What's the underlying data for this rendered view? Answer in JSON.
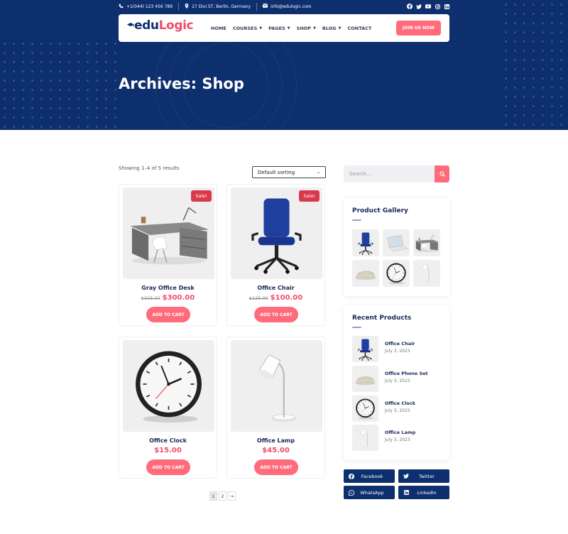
{
  "topbar": {
    "phone": "+1(044) 123 456 789",
    "address": "27 Divi ST, Berlin, Germany",
    "email": "info@edulogic.com",
    "social_icons": [
      "facebook-icon",
      "twitter-icon",
      "youtube-icon",
      "instagram-icon",
      "linkedin-icon"
    ]
  },
  "logo": {
    "part1": "edu",
    "part2": "Logic"
  },
  "nav": {
    "items": [
      {
        "label": "HOME",
        "dropdown": false
      },
      {
        "label": "COURSES",
        "dropdown": true
      },
      {
        "label": "PAGES",
        "dropdown": true
      },
      {
        "label": "SHOP",
        "dropdown": true
      },
      {
        "label": "BLOG",
        "dropdown": true
      },
      {
        "label": "CONTACT",
        "dropdown": false
      }
    ],
    "cta": "JOIN US NOW"
  },
  "page": {
    "title": "Archives: Shop"
  },
  "shop": {
    "result_count": "Showing 1–4 of 5 results",
    "sorting": "Default sorting",
    "products": [
      {
        "name": "Gray Office Desk",
        "old_price": "$325.00",
        "price": "$300.00",
        "badge": "Sale!",
        "button": "ADD TO CART"
      },
      {
        "name": "Office Chair",
        "old_price": "$125.00",
        "price": "$100.00",
        "badge": "Sale!",
        "button": "ADD TO CART"
      },
      {
        "name": "Office Clock",
        "old_price": "",
        "price": "$15.00",
        "badge": "",
        "button": "ADD TO CART"
      },
      {
        "name": "Office Lamp",
        "old_price": "",
        "price": "$45.00",
        "badge": "",
        "button": "ADD TO CART"
      }
    ],
    "pagination": {
      "current": "1",
      "next_page": "2",
      "next_arrow": "→"
    }
  },
  "sidebar": {
    "search_placeholder": "Search...",
    "gallery": {
      "title": "Product Gallery"
    },
    "recent": {
      "title": "Recent Products",
      "items": [
        {
          "name": "Office Chair",
          "date": "July 3, 2023"
        },
        {
          "name": "Office Phone Set",
          "date": "July 3, 2023"
        },
        {
          "name": "Office Clock",
          "date": "July 3, 2023"
        },
        {
          "name": "Office Lamp",
          "date": "July 3, 2023"
        }
      ]
    },
    "share": [
      {
        "label": "Facebook",
        "icon": "facebook-icon"
      },
      {
        "label": "Twitter",
        "icon": "twitter-icon"
      },
      {
        "label": "WhatsApp",
        "icon": "whatsapp-icon"
      },
      {
        "label": "LinkedIn",
        "icon": "linkedin-icon"
      }
    ]
  },
  "colors": {
    "navy": "#0e2f6e",
    "accent": "#ff6b7a",
    "sale": "#d83a4c",
    "price": "#f04e6a"
  }
}
